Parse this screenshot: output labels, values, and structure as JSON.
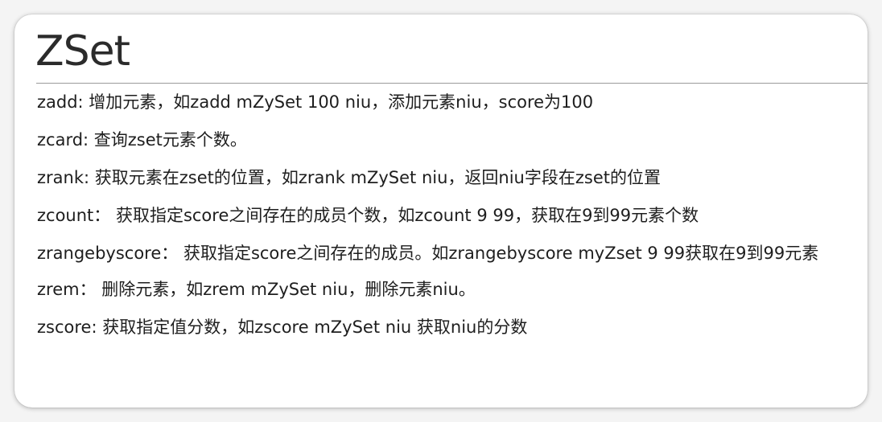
{
  "slide": {
    "title": "ZSet",
    "lines": [
      "zadd: 增加元素，如zadd mZySet 100 niu，添加元素niu，score为100",
      "zcard: 查询zset元素个数。",
      "zrank: 获取元素在zset的位置，如zrank mZySet niu，返回niu字段在zset的位置",
      "zcount： 获取指定score之间存在的成员个数，如zcount 9 99，获取在9到99元素个数",
      "zrangebyscore： 获取指定score之间存在的成员。如zrangebyscore myZset 9 99获取在9到99元素",
      "zrem： 删除元素，如zrem mZySet niu，删除元素niu。",
      "zscore: 获取指定值分数，如zscore mZySet niu 获取niu的分数"
    ]
  }
}
